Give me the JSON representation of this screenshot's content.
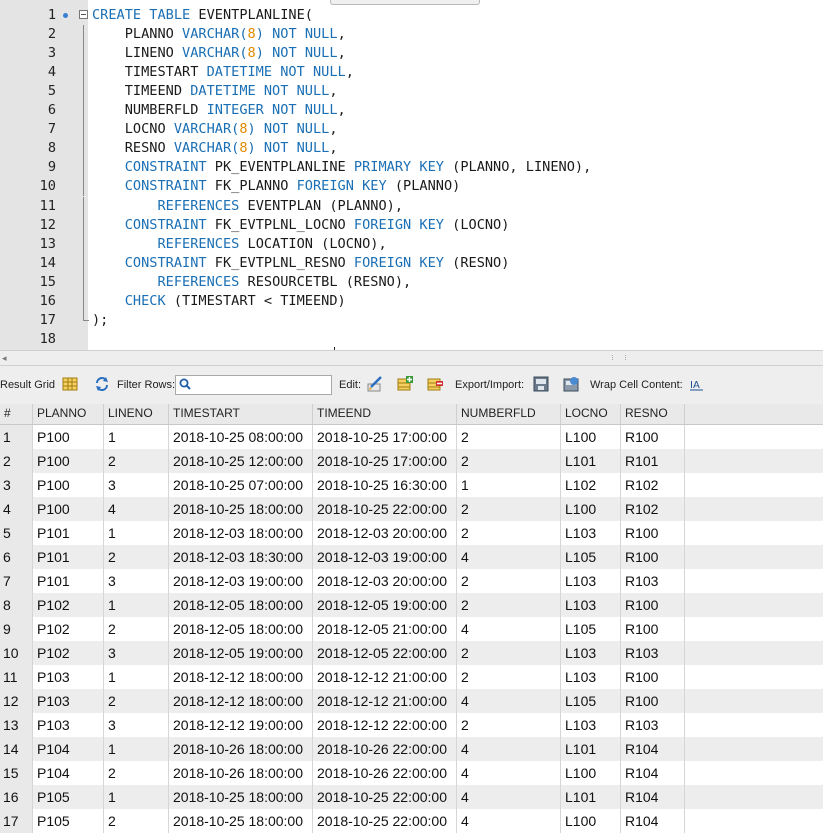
{
  "editor": {
    "lines": [
      [
        {
          "t": "CREATE TABLE",
          "c": "kw"
        },
        {
          "t": " EVENTPLANLINE("
        }
      ],
      [
        {
          "t": "    PLANNO "
        },
        {
          "t": "VARCHAR(",
          "c": "kw"
        },
        {
          "t": "8",
          "c": "num"
        },
        {
          "t": ")",
          "c": "kw"
        },
        {
          "t": " "
        },
        {
          "t": "NOT NULL",
          "c": "kw"
        },
        {
          "t": ","
        }
      ],
      [
        {
          "t": "    LINENO "
        },
        {
          "t": "VARCHAR(",
          "c": "kw"
        },
        {
          "t": "8",
          "c": "num"
        },
        {
          "t": ")",
          "c": "kw"
        },
        {
          "t": " "
        },
        {
          "t": "NOT NULL",
          "c": "kw"
        },
        {
          "t": ","
        }
      ],
      [
        {
          "t": "    TIMESTART "
        },
        {
          "t": "DATETIME NOT NULL",
          "c": "kw"
        },
        {
          "t": ","
        }
      ],
      [
        {
          "t": "    TIMEEND "
        },
        {
          "t": "DATETIME NOT NULL",
          "c": "kw"
        },
        {
          "t": ","
        }
      ],
      [
        {
          "t": "    NUMBERFLD "
        },
        {
          "t": "INTEGER NOT NULL",
          "c": "kw"
        },
        {
          "t": ","
        }
      ],
      [
        {
          "t": "    LOCNO "
        },
        {
          "t": "VARCHAR(",
          "c": "kw"
        },
        {
          "t": "8",
          "c": "num"
        },
        {
          "t": ")",
          "c": "kw"
        },
        {
          "t": " "
        },
        {
          "t": "NOT NULL",
          "c": "kw"
        },
        {
          "t": ","
        }
      ],
      [
        {
          "t": "    RESNO "
        },
        {
          "t": "VARCHAR(",
          "c": "kw"
        },
        {
          "t": "8",
          "c": "num"
        },
        {
          "t": ")",
          "c": "kw"
        },
        {
          "t": " "
        },
        {
          "t": "NOT NULL",
          "c": "kw"
        },
        {
          "t": ","
        }
      ],
      [
        {
          "t": "    "
        },
        {
          "t": "CONSTRAINT",
          "c": "kw"
        },
        {
          "t": " PK_EVENTPLANLINE "
        },
        {
          "t": "PRIMARY KEY",
          "c": "kw"
        },
        {
          "t": " (PLANNO, LINENO),"
        }
      ],
      [
        {
          "t": "    "
        },
        {
          "t": "CONSTRAINT",
          "c": "kw"
        },
        {
          "t": " FK_PLANNO "
        },
        {
          "t": "FOREIGN KEY",
          "c": "kw"
        },
        {
          "t": " (PLANNO)"
        }
      ],
      [
        {
          "t": "        "
        },
        {
          "t": "REFERENCES",
          "c": "kw"
        },
        {
          "t": " EVENTPLAN (PLANNO),"
        }
      ],
      [
        {
          "t": "    "
        },
        {
          "t": "CONSTRAINT",
          "c": "kw"
        },
        {
          "t": " FK_EVTPLNL_LOCNO "
        },
        {
          "t": "FOREIGN KEY",
          "c": "kw"
        },
        {
          "t": " (LOCNO)"
        }
      ],
      [
        {
          "t": "        "
        },
        {
          "t": "REFERENCES",
          "c": "kw"
        },
        {
          "t": " LOCATION (LOCNO),"
        }
      ],
      [
        {
          "t": "    "
        },
        {
          "t": "CONSTRAINT",
          "c": "kw"
        },
        {
          "t": " FK_EVTPLNL_RESNO "
        },
        {
          "t": "FOREIGN KEY",
          "c": "kw"
        },
        {
          "t": " (RESNO)"
        }
      ],
      [
        {
          "t": "        "
        },
        {
          "t": "REFERENCES",
          "c": "kw"
        },
        {
          "t": " RESOURCETBL (RESNO),"
        }
      ],
      [
        {
          "t": "    "
        },
        {
          "t": "CHECK",
          "c": "kw"
        },
        {
          "t": " (TIMESTART < TIMEEND)"
        }
      ],
      [
        {
          "t": ");"
        }
      ],
      []
    ]
  },
  "toolbar": {
    "result_grid": "Result Grid",
    "filter_rows": "Filter Rows:",
    "edit": "Edit:",
    "export_import": "Export/Import:",
    "wrap_cell": "Wrap Cell Content:"
  },
  "grid": {
    "columns": [
      "#",
      "PLANNO",
      "LINENO",
      "TIMESTART",
      "TIMEEND",
      "NUMBERFLD",
      "LOCNO",
      "RESNO"
    ],
    "rows": [
      [
        "1",
        "P100",
        "1",
        "2018-10-25 08:00:00",
        "2018-10-25 17:00:00",
        "2",
        "L100",
        "R100"
      ],
      [
        "2",
        "P100",
        "2",
        "2018-10-25 12:00:00",
        "2018-10-25 17:00:00",
        "2",
        "L101",
        "R101"
      ],
      [
        "3",
        "P100",
        "3",
        "2018-10-25 07:00:00",
        "2018-10-25 16:30:00",
        "1",
        "L102",
        "R102"
      ],
      [
        "4",
        "P100",
        "4",
        "2018-10-25 18:00:00",
        "2018-10-25 22:00:00",
        "2",
        "L100",
        "R102"
      ],
      [
        "5",
        "P101",
        "1",
        "2018-12-03 18:00:00",
        "2018-12-03 20:00:00",
        "2",
        "L103",
        "R100"
      ],
      [
        "6",
        "P101",
        "2",
        "2018-12-03 18:30:00",
        "2018-12-03 19:00:00",
        "4",
        "L105",
        "R100"
      ],
      [
        "7",
        "P101",
        "3",
        "2018-12-03 19:00:00",
        "2018-12-03 20:00:00",
        "2",
        "L103",
        "R103"
      ],
      [
        "8",
        "P102",
        "1",
        "2018-12-05 18:00:00",
        "2018-12-05 19:00:00",
        "2",
        "L103",
        "R100"
      ],
      [
        "9",
        "P102",
        "2",
        "2018-12-05 18:00:00",
        "2018-12-05 21:00:00",
        "4",
        "L105",
        "R100"
      ],
      [
        "10",
        "P102",
        "3",
        "2018-12-05 19:00:00",
        "2018-12-05 22:00:00",
        "2",
        "L103",
        "R103"
      ],
      [
        "11",
        "P103",
        "1",
        "2018-12-12 18:00:00",
        "2018-12-12 21:00:00",
        "2",
        "L103",
        "R100"
      ],
      [
        "12",
        "P103",
        "2",
        "2018-12-12 18:00:00",
        "2018-12-12 21:00:00",
        "4",
        "L105",
        "R100"
      ],
      [
        "13",
        "P103",
        "3",
        "2018-12-12 19:00:00",
        "2018-12-12 22:00:00",
        "2",
        "L103",
        "R103"
      ],
      [
        "14",
        "P104",
        "1",
        "2018-10-26 18:00:00",
        "2018-10-26 22:00:00",
        "4",
        "L101",
        "R104"
      ],
      [
        "15",
        "P104",
        "2",
        "2018-10-26 18:00:00",
        "2018-10-26 22:00:00",
        "4",
        "L100",
        "R104"
      ],
      [
        "16",
        "P105",
        "1",
        "2018-10-25 18:00:00",
        "2018-10-25 22:00:00",
        "4",
        "L101",
        "R104"
      ],
      [
        "17",
        "P105",
        "2",
        "2018-10-25 18:00:00",
        "2018-10-25 22:00:00",
        "4",
        "L100",
        "R104"
      ]
    ]
  }
}
